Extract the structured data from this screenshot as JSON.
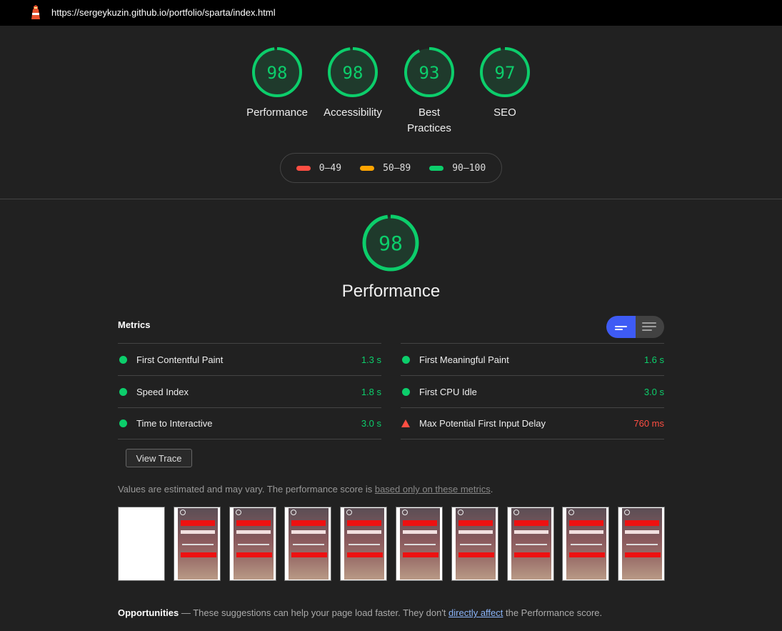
{
  "browser": {
    "url": "https://sergeykuzin.github.io/portfolio/sparta/index.html",
    "logo_icon": "lighthouse-icon"
  },
  "colors": {
    "pass": "#0cce6b",
    "average": "#ffa400",
    "fail": "#ff4e42",
    "accent": "#3e5bf5"
  },
  "gauges": [
    {
      "score": "98",
      "label": "Performance",
      "fraction": 0.98
    },
    {
      "score": "98",
      "label": "Accessibility",
      "fraction": 0.98
    },
    {
      "score": "93",
      "label": "Best Practices",
      "fraction": 0.93
    },
    {
      "score": "97",
      "label": "SEO",
      "fraction": 0.97
    }
  ],
  "legend": [
    {
      "range": "0–49",
      "color": "#ff4e42"
    },
    {
      "range": "50–89",
      "color": "#ffa400"
    },
    {
      "range": "90–100",
      "color": "#0cce6b"
    }
  ],
  "performance": {
    "score": "98",
    "fraction": 0.98,
    "title": "Performance",
    "metrics_heading": "Metrics",
    "metrics_left": [
      {
        "name": "First Contentful Paint",
        "value": "1.3 s",
        "status": "pass"
      },
      {
        "name": "Speed Index",
        "value": "1.8 s",
        "status": "pass"
      },
      {
        "name": "Time to Interactive",
        "value": "3.0 s",
        "status": "pass"
      }
    ],
    "metrics_right": [
      {
        "name": "First Meaningful Paint",
        "value": "1.6 s",
        "status": "pass"
      },
      {
        "name": "First CPU Idle",
        "value": "3.0 s",
        "status": "pass"
      },
      {
        "name": "Max Potential First Input Delay",
        "value": "760 ms",
        "status": "fail"
      }
    ],
    "view_trace": "View Trace",
    "note_prefix": "Values are estimated and may vary. The performance score is ",
    "note_link": "based only on these metrics",
    "note_suffix": ".",
    "filmstrip_frames": 10
  },
  "opportunities": {
    "heading": "Opportunities",
    "text_prefix": " — These suggestions can help your page load faster. They don't ",
    "link": "directly affect",
    "text_suffix": " the Performance score."
  }
}
